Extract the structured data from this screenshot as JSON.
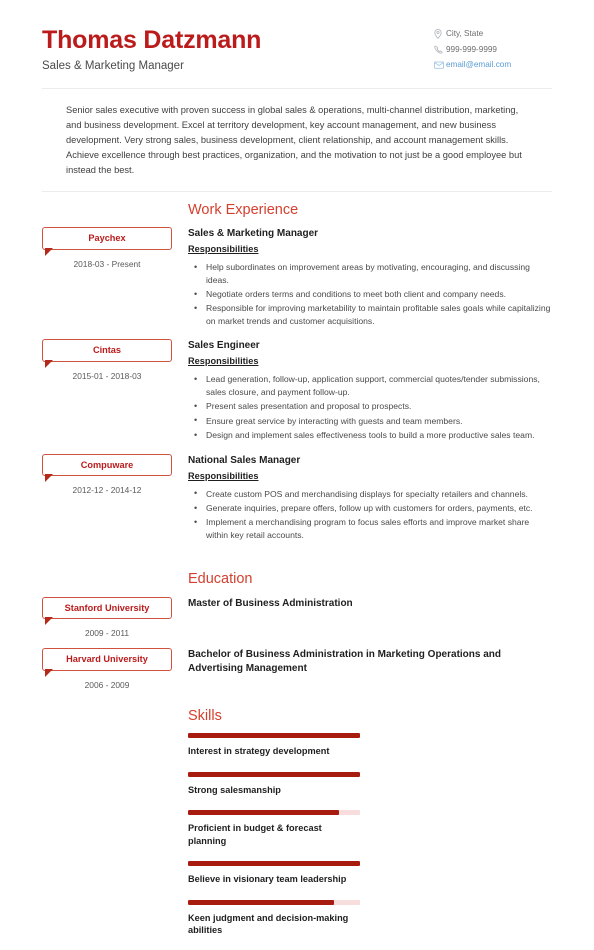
{
  "header": {
    "name": "Thomas Datzmann",
    "job_title": "Sales & Marketing Manager",
    "contact": {
      "location": "City, State",
      "phone": "999-999-9999",
      "email": "email@email.com",
      "location_icon": "location-pin-icon",
      "phone_icon": "phone-icon",
      "email_icon": "envelope-icon"
    }
  },
  "summary": "Senior sales executive with proven success in global sales & operations, multi-channel distribution, marketing, and business development. Excel at territory development, key account management, and new business development. Very strong sales, business development, client relationship, and account management skills. Achieve excellence through best practices, organization, and the motivation to not just be a good employee but instead the best.",
  "work_experience": {
    "title": "Work Experience",
    "entries": [
      {
        "company": "Paychex",
        "dates": "2018-03 - Present",
        "position": "Sales & Marketing Manager",
        "responsibilities_label": "Responsibilities",
        "bullets": [
          "Help subordinates on improvement areas by motivating, encouraging, and discussing ideas.",
          "Negotiate orders terms and conditions to meet both client and company needs.",
          "Responsible for improving marketability to maintain profitable sales goals while capitalizing on market trends and customer acquisitions."
        ]
      },
      {
        "company": "Cintas",
        "dates": "2015-01 - 2018-03",
        "position": "Sales Engineer",
        "responsibilities_label": "Responsibilities",
        "bullets": [
          "Lead generation, follow-up, application support, commercial quotes/tender submissions, sales closure, and payment follow-up.",
          "Present sales presentation and proposal to prospects.",
          "Ensure great service by interacting with guests and team members.",
          "Design and implement sales effectiveness tools to build a more productive sales team."
        ]
      },
      {
        "company": "Compuware",
        "dates": "2012-12 - 2014-12",
        "position": "National Sales Manager",
        "responsibilities_label": "Responsibilities",
        "bullets": [
          "Create custom POS and merchandising displays for specialty retailers and channels.",
          "Generate inquiries, prepare offers, follow up with customers for orders, payments, etc.",
          "Implement a merchandising program to focus sales efforts and improve market share within key retail accounts."
        ]
      }
    ]
  },
  "education": {
    "title": "Education",
    "entries": [
      {
        "school": "Stanford University",
        "dates": "2009 - 2011",
        "degree": "Master of Business Administration"
      },
      {
        "school": "Harvard University",
        "dates": "2006 - 2009",
        "degree": "Bachelor of Business Administration in Marketing Operations and Advertising Management"
      }
    ]
  },
  "skills": {
    "title": "Skills",
    "items": [
      {
        "label": "Interest in strategy development",
        "level": 100
      },
      {
        "label": "Strong salesmanship",
        "level": 100
      },
      {
        "label": "Proficient in budget & forecast planning",
        "level": 88
      },
      {
        "label": "Believe in visionary team leadership",
        "level": 100
      },
      {
        "label": "Keen judgment and decision-making abilities",
        "level": 85
      }
    ]
  },
  "colors": {
    "name_red": "#bb1b1b",
    "section_heading": "#d4402f",
    "badge_border": "#d1513f",
    "bar_fill": "#a81c10",
    "bar_track": "#f7dedc",
    "email_link": "#5b9bd5"
  }
}
